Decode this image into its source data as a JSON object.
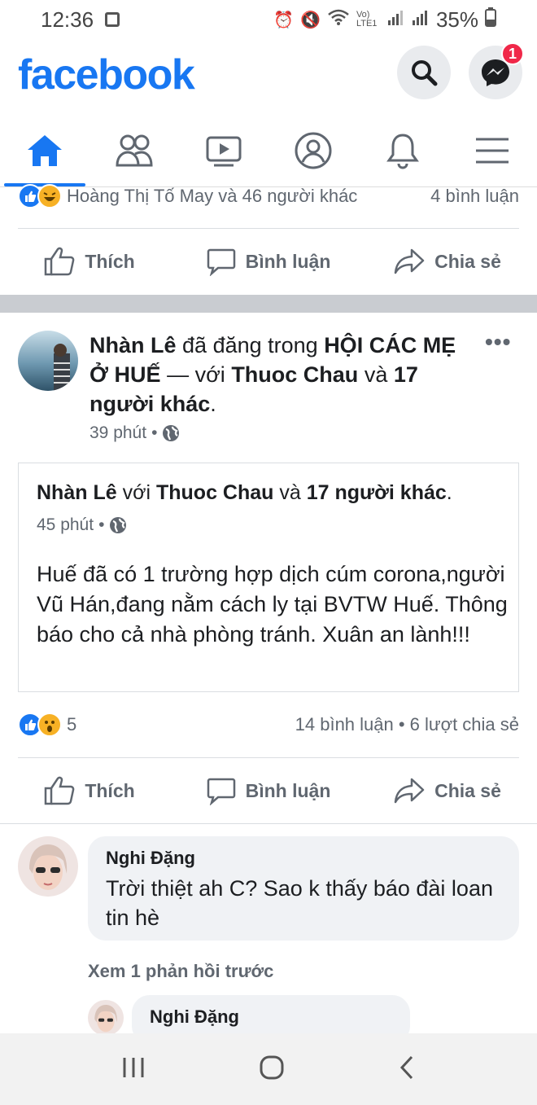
{
  "status_bar": {
    "time": "12:36",
    "battery": "35%",
    "network_label": "Vo) LTE1"
  },
  "header": {
    "logo": "facebook",
    "messenger_badge": "1",
    "brand_color": "#1877f2"
  },
  "nav_tabs": [
    {
      "name": "home",
      "icon": "home-icon",
      "active": true
    },
    {
      "name": "friends",
      "icon": "friends-icon",
      "active": false
    },
    {
      "name": "watch",
      "icon": "video-icon",
      "active": false
    },
    {
      "name": "profile",
      "icon": "profile-icon",
      "active": false
    },
    {
      "name": "notifications",
      "icon": "bell-icon",
      "active": false
    },
    {
      "name": "menu",
      "icon": "hamburger-icon",
      "active": false
    }
  ],
  "prev_post": {
    "reactions_text": "Hoàng Thị Tố May và 46 người khác",
    "comments_text": "4 bình luận"
  },
  "actions": {
    "like": "Thích",
    "comment": "Bình luận",
    "share": "Chia sẻ"
  },
  "post": {
    "author": "Nhàn Lê",
    "posted_in": "đã đăng trong",
    "group": "HỘI CÁC MẸ Ở HUẾ",
    "dash": "—",
    "with_word": "với",
    "tagged": "Thuoc Chau",
    "and_word": "và",
    "others": "17 người khác",
    "period": ".",
    "time": "39 phút",
    "dot": "•",
    "more": "•••",
    "shared": {
      "author": "Nhàn Lê",
      "with_word": "với",
      "tagged": "Thuoc Chau",
      "and_word": "và",
      "others": "17 người khác",
      "period": ".",
      "time": "45 phút",
      "body": "Huế đã có 1 trường hợp dịch cúm corona,người Vũ Hán,đang nằm cách ly tại BVTW Huế. Thông báo cho cả nhà phòng tránh. Xuân an lành!!!"
    },
    "reaction_count": "5",
    "comments_shares": "14 bình luận • 6 lượt chia sẻ"
  },
  "comments": [
    {
      "name": "Nghi Đặng",
      "text": "Trời thiệt ah C? Sao k thấy báo đài loan tin hè"
    }
  ],
  "view_previous": "Xem 1 phản hồi trước",
  "reply": {
    "name": "Nghi Đặng"
  }
}
